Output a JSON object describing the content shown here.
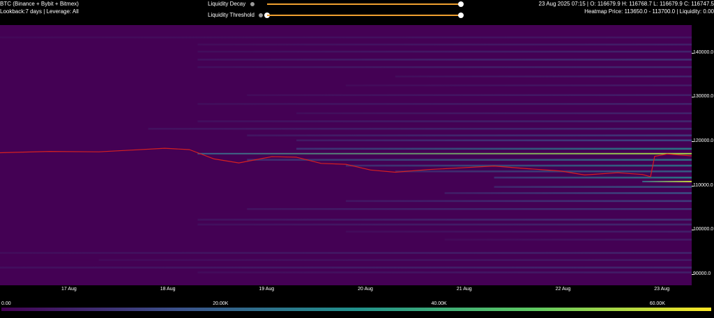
{
  "header": {
    "title": "BTC (Binance + Bybit + Bitmex)",
    "lookback": "Lookback:7 days | Leverage: All",
    "ohlc": "23 Aug 2025 07:15 | O: 116679.9 H: 116768.7 L: 116679.9 C: 116747.5",
    "heatmap_info": "Heatmap Price: 113650.0 - 113700.0 | Liquidity: 0.00"
  },
  "controls": {
    "decay_label": "Liquidity Decay",
    "threshold_label": "Liquidity Threshold",
    "decay_value": 1.0,
    "threshold_value": 1.0,
    "track_color": "#f0a030",
    "info_icon": "info-icon"
  },
  "chart_data": {
    "type": "heatmap",
    "title": "",
    "xlabel": "",
    "ylabel": "",
    "x_ticks": [
      "17 Aug",
      "18 Aug",
      "19 Aug",
      "20 Aug",
      "21 Aug",
      "22 Aug",
      "23 Aug"
    ],
    "y_ticks": [
      90000,
      100000,
      110000,
      120000,
      130000,
      140000
    ],
    "y_tick_labels": [
      "90000.0",
      "100000.0",
      "110000.0",
      "120000.0",
      "130000.0",
      "140000.0"
    ],
    "ylim": [
      87500,
      146200
    ],
    "xlim": [
      "16 Aug 2025 07:15",
      "23 Aug 2025 07:15"
    ],
    "colorscale": {
      "min": 0,
      "max": 65000,
      "ticks": [
        0,
        20000,
        40000,
        60000
      ],
      "tick_labels": [
        "0.00",
        "20.00K",
        "40.00K",
        "60.00K"
      ],
      "colors": [
        "#440154",
        "#3b528b",
        "#21918c",
        "#5ec962",
        "#fde725"
      ]
    },
    "price_series": {
      "color": "#d62020",
      "points": [
        {
          "t": "16 Aug 2025 07:15",
          "price": 117400
        },
        {
          "t": "16 Aug 2025 19:15",
          "price": 117700
        },
        {
          "t": "17 Aug 2025 07:15",
          "price": 117600
        },
        {
          "t": "17 Aug 2025 15:15",
          "price": 118000
        },
        {
          "t": "17 Aug 2025 23:15",
          "price": 118400
        },
        {
          "t": "18 Aug 2025 05:15",
          "price": 118100
        },
        {
          "t": "18 Aug 2025 11:15",
          "price": 116000
        },
        {
          "t": "18 Aug 2025 17:15",
          "price": 115100
        },
        {
          "t": "19 Aug 2025 01:15",
          "price": 116500
        },
        {
          "t": "19 Aug 2025 07:15",
          "price": 116400
        },
        {
          "t": "19 Aug 2025 13:15",
          "price": 115000
        },
        {
          "t": "19 Aug 2025 19:15",
          "price": 114800
        },
        {
          "t": "20 Aug 2025 01:15",
          "price": 113500
        },
        {
          "t": "20 Aug 2025 07:15",
          "price": 113000
        },
        {
          "t": "20 Aug 2025 15:15",
          "price": 113600
        },
        {
          "t": "20 Aug 2025 23:15",
          "price": 114000
        },
        {
          "t": "21 Aug 2025 07:15",
          "price": 114400
        },
        {
          "t": "21 Aug 2025 15:15",
          "price": 113800
        },
        {
          "t": "21 Aug 2025 23:15",
          "price": 113300
        },
        {
          "t": "22 Aug 2025 05:15",
          "price": 112400
        },
        {
          "t": "22 Aug 2025 13:15",
          "price": 112900
        },
        {
          "t": "22 Aug 2025 19:15",
          "price": 112500
        },
        {
          "t": "22 Aug 2025 21:15",
          "price": 112000
        },
        {
          "t": "22 Aug 2025 22:15",
          "price": 116600
        },
        {
          "t": "23 Aug 2025 01:15",
          "price": 117100
        },
        {
          "t": "23 Aug 2025 07:15",
          "price": 116700
        }
      ]
    },
    "liquidity_levels": [
      {
        "price": 117200,
        "liquidity": 56000,
        "from": "18 Aug 2025 07:15"
      },
      {
        "price": 110900,
        "liquidity": 60000,
        "from": "22 Aug 2025 19:15"
      },
      {
        "price": 118300,
        "liquidity": 30000,
        "from": "19 Aug 2025 07:15"
      },
      {
        "price": 115800,
        "liquidity": 28000,
        "from": "18 Aug 2025 19:15"
      },
      {
        "price": 114500,
        "liquidity": 27000,
        "from": "19 Aug 2025 19:15"
      },
      {
        "price": 113200,
        "liquidity": 22000,
        "from": "20 Aug 2025 07:15"
      },
      {
        "price": 111800,
        "liquidity": 30000,
        "from": "21 Aug 2025 07:15"
      },
      {
        "price": 109700,
        "liquidity": 22000,
        "from": "21 Aug 2025 07:15"
      },
      {
        "price": 108300,
        "liquidity": 18000,
        "from": "20 Aug 2025 19:15"
      },
      {
        "price": 106500,
        "liquidity": 14000,
        "from": "19 Aug 2025 19:15"
      },
      {
        "price": 104700,
        "liquidity": 12000,
        "from": "18 Aug 2025 19:15"
      },
      {
        "price": 102300,
        "liquidity": 11000,
        "from": "18 Aug 2025 07:15"
      },
      {
        "price": 101200,
        "liquidity": 9000,
        "from": "18 Aug 2025 07:15"
      },
      {
        "price": 99600,
        "liquidity": 7000,
        "from": "19 Aug 2025 19:15"
      },
      {
        "price": 97800,
        "liquidity": 6000,
        "from": "20 Aug 2025 19:15"
      },
      {
        "price": 94800,
        "liquidity": 8000,
        "from": "16 Aug 2025 07:15"
      },
      {
        "price": 93200,
        "liquidity": 6000,
        "from": "17 Aug 2025 07:15"
      },
      {
        "price": 91500,
        "liquidity": 9000,
        "from": "16 Aug 2025 07:15"
      },
      {
        "price": 90400,
        "liquidity": 7000,
        "from": "18 Aug 2025 07:15"
      },
      {
        "price": 120200,
        "liquidity": 16000,
        "from": "19 Aug 2025 07:15"
      },
      {
        "price": 121300,
        "liquidity": 13000,
        "from": "18 Aug 2025 19:15"
      },
      {
        "price": 122800,
        "liquidity": 11000,
        "from": "17 Aug 2025 19:15"
      },
      {
        "price": 124500,
        "liquidity": 9000,
        "from": "18 Aug 2025 07:15"
      },
      {
        "price": 126300,
        "liquidity": 8000,
        "from": "19 Aug 2025 07:15"
      },
      {
        "price": 128400,
        "liquidity": 8000,
        "from": "18 Aug 2025 07:15"
      },
      {
        "price": 130400,
        "liquidity": 7000,
        "from": "18 Aug 2025 19:15"
      },
      {
        "price": 132600,
        "liquidity": 6000,
        "from": "19 Aug 2025 19:15"
      },
      {
        "price": 134600,
        "liquidity": 8000,
        "from": "20 Aug 2025 07:15"
      },
      {
        "price": 136700,
        "liquidity": 9000,
        "from": "18 Aug 2025 07:15"
      },
      {
        "price": 138400,
        "liquidity": 11000,
        "from": "18 Aug 2025 07:15"
      },
      {
        "price": 140200,
        "liquidity": 8000,
        "from": "18 Aug 2025 07:15"
      },
      {
        "price": 141800,
        "liquidity": 7000,
        "from": "18 Aug 2025 07:15"
      },
      {
        "price": 143400,
        "liquidity": 5000,
        "from": "16 Aug 2025 07:15"
      }
    ]
  }
}
